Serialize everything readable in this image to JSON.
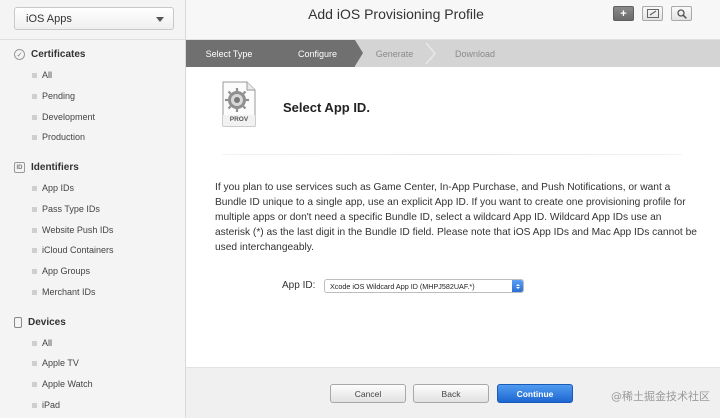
{
  "sidebar": {
    "platform": "iOS Apps",
    "sections": [
      {
        "title": "Certificates",
        "icon": "certificate-icon",
        "items": [
          "All",
          "Pending",
          "Development",
          "Production"
        ]
      },
      {
        "title": "Identifiers",
        "icon": "id-icon",
        "items": [
          "App IDs",
          "Pass Type IDs",
          "Website Push IDs",
          "iCloud Containers",
          "App Groups",
          "Merchant IDs"
        ]
      },
      {
        "title": "Devices",
        "icon": "device-icon",
        "items": [
          "All",
          "Apple TV",
          "Apple Watch",
          "iPad"
        ]
      }
    ]
  },
  "header": {
    "title": "Add iOS Provisioning Profile",
    "tools": [
      "plus-icon",
      "edit-icon",
      "search-icon"
    ]
  },
  "steps": [
    {
      "label": "Select Type",
      "state": "done"
    },
    {
      "label": "Configure",
      "state": "current"
    },
    {
      "label": "Generate",
      "state": "todo"
    },
    {
      "label": "Download",
      "state": "todo"
    }
  ],
  "content": {
    "icon_label": "PROV",
    "section_title": "Select App ID.",
    "description": "If you plan to use services such as Game Center, In-App Purchase, and Push Notifications, or want a Bundle ID unique to a single app, use an explicit App ID. If you want to create one provisioning profile for multiple apps or don't need a specific Bundle ID, select a wildcard App ID. Wildcard App IDs use an asterisk (*) as the last digit in the Bundle ID field. Please note that iOS App IDs and Mac App IDs cannot be used interchangeably.",
    "app_id_label": "App ID:",
    "app_id_value": "Xcode iOS Wildcard App ID (MHPJ582UAF.*)"
  },
  "footer": {
    "cancel": "Cancel",
    "back": "Back",
    "continue": "Continue",
    "watermark": "@稀土掘金技术社区"
  },
  "colors": {
    "accent": "#2a74d6",
    "step_done": "#707070",
    "step_bar": "#d4d4d4"
  }
}
